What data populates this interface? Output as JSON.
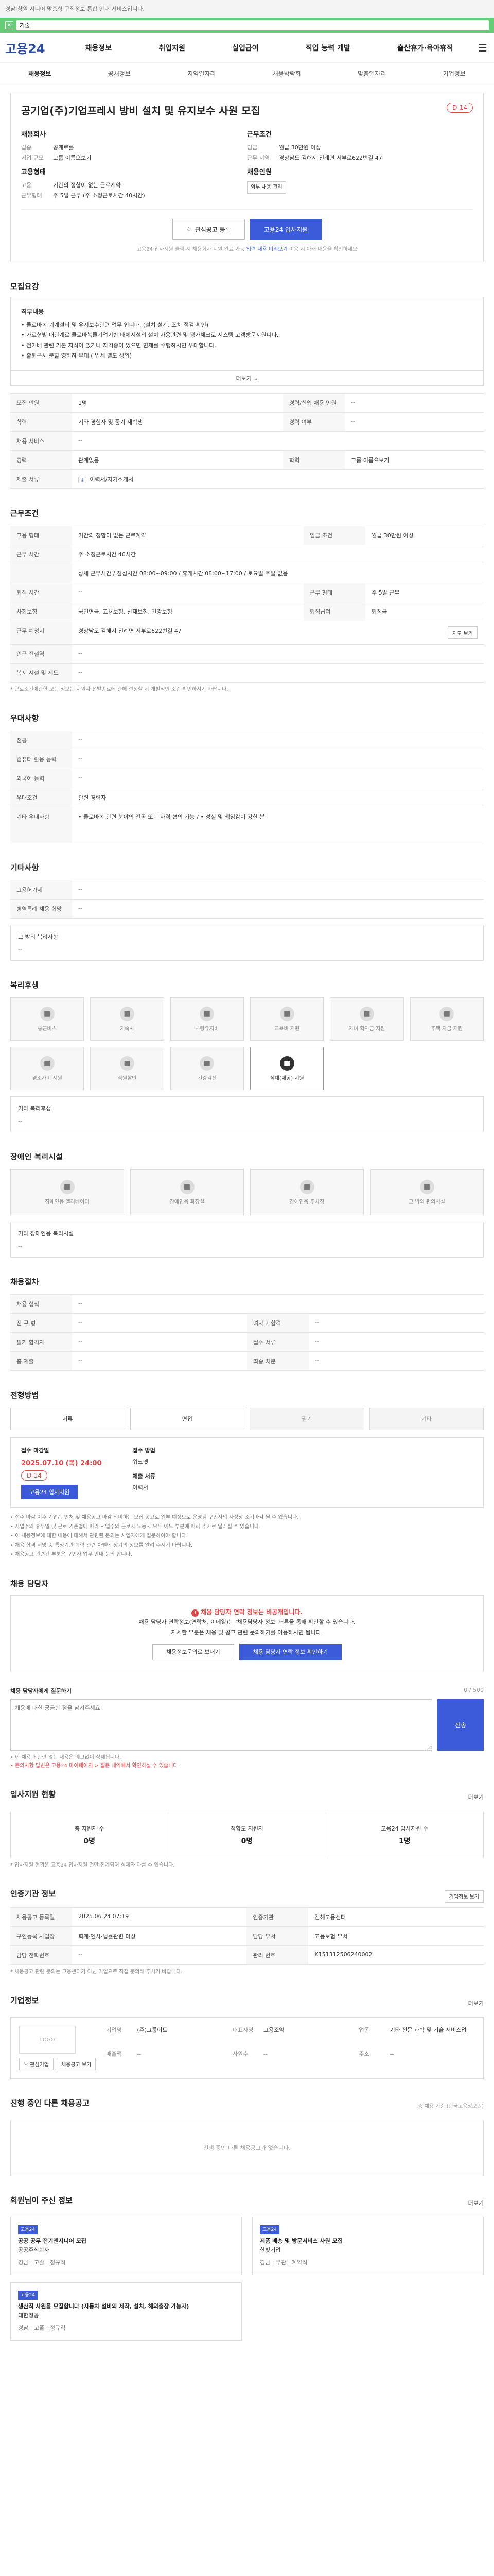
{
  "topbar": {
    "notice": "경남 창원 시니어 맞춤형 구직정보 통합 안내 서비스입니다."
  },
  "search": {
    "value": "기술"
  },
  "header": {
    "logo": "고용24",
    "menu": [
      "채용정보",
      "취업지원",
      "실업급여",
      "직업 능력 개발",
      "출산휴가·육아휴직"
    ]
  },
  "subnav": [
    "채용정보",
    "공채정보",
    "지역일자리",
    "채용박람회",
    "맞춤일자리",
    "기업정보"
  ],
  "job": {
    "title": "공기업(주)기업프레시 방비 설치 및 유지보수 사원 모집",
    "dday": "D-14",
    "company_label": "채용회사",
    "company_rows": [
      [
        "업종",
        "공계로를"
      ],
      [
        "기업 규모",
        "그룹 이름으보기"
      ]
    ],
    "condition_label": "근무조건",
    "condition_rows": [
      [
        "임금",
        "월급 30만원 이상"
      ],
      [
        "근무 지역",
        "경상남도 김해시 진례면 서부로622번길 47"
      ]
    ],
    "qual_label": "고용형태",
    "qual_rows": [
      [
        "고용",
        "기간의 정함이 없는 근로계약"
      ],
      [
        "근무형태",
        "주 5일 근무 (주 소정근로시간 40시간)"
      ]
    ],
    "career_label": "채용인원",
    "career_rows": [
      [
        "모집",
        "외부 채용 관리"
      ]
    ],
    "btn_interest": "관심공고 등록",
    "btn_apply": "고용24 입사지원",
    "apply_note_pre": "고용24 입사지원 클릭 시 채용회사 지원 완료 가능",
    "apply_note_link": "입력 내용 미리보기",
    "apply_note_post": "이용 시 아래 내용을 확인하세요"
  },
  "recruit": {
    "heading": "모집요강",
    "detail_title": "직무내용",
    "detail_lines": [
      "• 클로바녹 기계설비 및 유지보수관련 업무 입니다. (설치 설계, 조치 점검·확인)",
      "• 가로형별 대관계로 클로바녹클기업기반 배에시설의 설치 사용관련 및 평가체크로 시스템 고객방문지원니다.",
      "• 전기배 관련 기본 지식이 있거나 자격증이 있으면 면제를 수행하시면 우대합니다.",
      "• 출퇴근시 분할 영하하 우대 ( 업세 별도 상의)"
    ],
    "more": "더보기",
    "rows": [
      {
        "k": "모집 인원",
        "v": "1명",
        "k2": "경력/신입 채용 인원",
        "v2": "--"
      },
      {
        "k": "학력",
        "v": "기타 경험자 및 중기 재학생",
        "k2": "경력 여부",
        "v2": "--"
      },
      {
        "k": "채용 서비스",
        "v": "--",
        "k2": "",
        "v2": ""
      },
      {
        "k": "경력",
        "v": "관계없음",
        "k2": "학력",
        "v2": "그룹 이름으보기"
      },
      {
        "k": "제출 서류",
        "v": "이력서/자기소개서",
        "k2": "",
        "v2": ""
      }
    ]
  },
  "workcond": {
    "heading": "근무조건",
    "rows": [
      {
        "k": "고용 형태",
        "v": "기간의 정함이 없는 근로계약",
        "k2": "임금 조건",
        "v2": "월급 30만원 이상"
      },
      {
        "k": "근무 시간",
        "v": "주 소정근로시간 40시간",
        "k2": "",
        "v2": ""
      },
      {
        "k": "근무 시간 2",
        "v": "상세 근무시간 / 점심시간 08:00~09:00 / 휴게시간 08:00~17:00 / 토요일 주말 없음",
        "k2": "",
        "v2": ""
      },
      {
        "k": "퇴직 시간",
        "v": "--",
        "k2": "근무 형태",
        "v2": "주 5일 근무"
      },
      {
        "k": "사회보험",
        "v": "국민연금, 고용보험, 산재보험, 건강보험",
        "k2": "퇴직급여",
        "v2": "퇴직금"
      },
      {
        "k": "근무 예정지",
        "v": "경상남도 김해시 진례면 서부로622번길 47",
        "k2": "",
        "v2": ""
      },
      {
        "k": "인근 전철역",
        "v": "--",
        "k2": "",
        "v2": ""
      },
      {
        "k": "복지 시설 및 제도",
        "v": "--",
        "k2": "",
        "v2": ""
      }
    ],
    "map_btn": "지도 보기",
    "foot_note": "* 근로조건에관한 모든 정보는 지원자 선발종료에 관해 결정할 시 개별적인 조건 확인하시기 바랍니다."
  },
  "prefer": {
    "heading": "우대사항",
    "rows": [
      {
        "k": "전공",
        "v": "--"
      },
      {
        "k": "컴퓨터 활용 능력",
        "v": "--"
      },
      {
        "k": "외국어 능력",
        "v": "--"
      },
      {
        "k": "우대조건",
        "v": "관련 경력자"
      },
      {
        "k": "기타 우대사항",
        "v": "• 클로바녹 관련 분야의 전공 또는 자격 협의 가능 / • 성실 및 책임감이 강한 분"
      }
    ]
  },
  "other": {
    "heading": "기타사항",
    "rows": [
      {
        "k": "고용허가제",
        "v": "--"
      },
      {
        "k": "병역특례 채용 희망",
        "v": "--"
      }
    ],
    "extra_title": "그 밖의 복리사항",
    "extra_value": "--"
  },
  "welfare": {
    "heading": "복리후생",
    "tiles": [
      {
        "icon": "■",
        "label": "통근버스",
        "on": false
      },
      {
        "icon": "■",
        "label": "기숙사",
        "on": false
      },
      {
        "icon": "■",
        "label": "차량유지비",
        "on": false
      },
      {
        "icon": "■",
        "label": "교육비 지원",
        "on": false
      },
      {
        "icon": "■",
        "label": "자녀 학자금 지원",
        "on": false
      },
      {
        "icon": "■",
        "label": "주택 자금 지원",
        "on": false
      },
      {
        "icon": "■",
        "label": "경조사비 지원",
        "on": false
      },
      {
        "icon": "■",
        "label": "직원할인",
        "on": false
      },
      {
        "icon": "■",
        "label": "건강검진",
        "on": false
      },
      {
        "icon": "■",
        "label": "식대(제공) 지원",
        "on": true
      }
    ],
    "extra_title": "기타 복리후생",
    "extra_value": "--"
  },
  "disab": {
    "heading": "장애인 복리시설",
    "tiles": [
      {
        "icon": "■",
        "label": "장애인용 엘리베이터",
        "on": false
      },
      {
        "icon": "■",
        "label": "장애인용 화장실",
        "on": false
      },
      {
        "icon": "■",
        "label": "장애인용 주차장",
        "on": false
      },
      {
        "icon": "■",
        "label": "그 밖의 편의시설",
        "on": false
      }
    ],
    "extra_title": "기타 장애인용 복리시설",
    "extra_value": "--"
  },
  "procedure": {
    "heading": "채용절차",
    "rows": [
      {
        "k": "채용 형식",
        "v": "--",
        "k2": "",
        "v2": ""
      },
      {
        "k": "진 구 형",
        "v": "--",
        "k2": "여자고 합격",
        "v2": "--"
      },
      {
        "k": "필기 합격자",
        "v": "--",
        "k2": "접수 서류",
        "v2": "--"
      },
      {
        "k": "총 제출",
        "v": "--",
        "k2": "최종 처분",
        "v2": "--"
      }
    ]
  },
  "process": {
    "heading": "전형방법",
    "steps": [
      {
        "label": "서류",
        "on": true
      },
      {
        "label": "면접",
        "on": true
      },
      {
        "label": "필기",
        "on": false
      },
      {
        "label": "기타",
        "on": false
      }
    ],
    "deadline_title": "접수 마감일",
    "deadline": "2025.07.10 (목) 24:00",
    "dday": "D-14",
    "apply_method_title": "접수 방법",
    "apply_method": "워크넷",
    "form_title": "제출 서류",
    "form_value": "이력서",
    "apply_btn": "고용24 입사지원",
    "notices": [
      "접수 마감 이후 기업/구인처 및 채용공고 마감 의미하는 모집 공고로 일부 예정으로 운영됨 구인자의 사정상 조기마감 될 수 있습니다.",
      "사업주의 휴무일 및 근로 기준법에 따라 사업주와 근로자 노동자 모두 어느 부분에 따라 추가로 달라질 수 있습니다.",
      "이 채용정보에 대한 내용에 대해서 관련된 문의는 사업자에게 질문하여야 합니다.",
      "채용 합격 서명 중 특정기관 학력 관련 차별에 상기의 정보를 알려 주시기 바랍니다.",
      "채용공고 관련된 부분은 구인자 업무 안내 문의 합니다."
    ]
  },
  "contact": {
    "heading": "채용 담당자",
    "warn": "채용 담당자 연락 정보는 비공개입니다.",
    "line1": "채용 담당자 연락정보(연락처, 이메일)는 '채용담당자 정보' 버튼을 통해 확인할 수 있습니다.",
    "line2": "자세한 부분은 채용 및 공고 관련 문의하기를 이용하시면 됩니다.",
    "btn1": "채용정보문의로 보내기",
    "btn2": "채용 담당자 연락 정보 확인하기"
  },
  "qa": {
    "title": "채용 담당자에게 질문하기",
    "counter": "0 / 500",
    "placeholder": "채용에 대한 궁금한 점을 남겨주세요.",
    "send": "전송",
    "note1": "• 이 채용과 관련 없는 내용은 예고없이 삭제됩니다.",
    "note2": "• 문의사항 답변은 고용24 마이페이지 > 질문 내역에서 확인하실 수 있습니다."
  },
  "applicants": {
    "heading": "입사지원 현황",
    "link": "더보기",
    "stats": [
      {
        "label": "총 지원자 수",
        "value": "0명"
      },
      {
        "label": "적합도 지원자",
        "value": "0명"
      },
      {
        "label": "고용24 입사지원 수",
        "value": "1명"
      }
    ],
    "note": "* 입사지원 현황은 고용24 입사지원 건만 집계되어 실제와 다를 수 있습니다."
  },
  "agency": {
    "heading": "인증기관 정보",
    "link": "기업정보 보기",
    "rows": [
      {
        "k": "채용공고 등록일",
        "v": "2025.06.24 07:19",
        "k2": "인증기관",
        "v2": "김해고용센터"
      },
      {
        "k": "구인등록 사업장",
        "v": "회계·인사·법률관련 미상",
        "k2": "담당 부서",
        "v2": "고용보험 부서"
      },
      {
        "k": "담당 전화번호",
        "v": "--",
        "k2": "관리 번호",
        "v2": "K151312506240002"
      }
    ],
    "note": "* 채용공고 관련 문의는 고용센터가 아닌 기업으로 직접 문의해 주시기 바랍니다."
  },
  "company_info": {
    "heading": "기업정보",
    "link": "더보기",
    "logo_text": "LOGO",
    "fields": [
      [
        "기업명",
        "(주)그룹이트"
      ],
      [
        "대표자명",
        "고용조약"
      ],
      [
        "업종",
        "기타 전문 과학 및 기술 서비스업"
      ],
      [
        "매출액",
        "--"
      ],
      [
        "사원수",
        "--"
      ],
      [
        "주소",
        "--"
      ]
    ],
    "btn_favorite": "관심기업",
    "btn_more": "채용공고 보기"
  },
  "others": {
    "heading": "진행 중인 다른 채용공고",
    "count_note": "총 채용 기준 (한국고용정보원)",
    "empty": "진행 중인 다른 채용공고가 없습니다."
  },
  "recommend": {
    "heading": "회원님이 주신 정보",
    "link": "더보기",
    "cards": [
      {
        "badge": "고용24",
        "title": "공공 공무 전기엔지니어 모집",
        "company": "공공주식회사",
        "meta": "경남 | 고졸 | 정규직"
      },
      {
        "badge": "고용24",
        "title": "제품 배송 및 방문서비스 사원 모집",
        "company": "한빛기업",
        "meta": "경남 | 무관 | 계약직"
      },
      {
        "badge": "고용24",
        "title": "생산직 사원을 모집합니다 (자동차 설비의 제작, 설치, 해외출장 가능자)",
        "company": "대한정공",
        "meta": "경남 | 고졸 | 정규직"
      }
    ]
  }
}
